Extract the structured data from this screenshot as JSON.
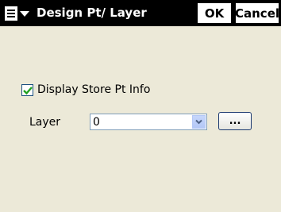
{
  "window": {
    "title": "Design Pt/ Layer",
    "ok_label": "OK",
    "cancel_label": "Cancel",
    "menu_icon": "menu-icon"
  },
  "form": {
    "display_store_pt_info": {
      "label": "Display Store Pt Info",
      "checked": true
    },
    "layer": {
      "label": "Layer",
      "value": "0"
    },
    "browse_label": "..."
  },
  "colors": {
    "titlebar": "#000000",
    "dialog_background": "#ece9d8",
    "checkbox_mark": "#21a121",
    "combo_border": "#7f9db9"
  }
}
